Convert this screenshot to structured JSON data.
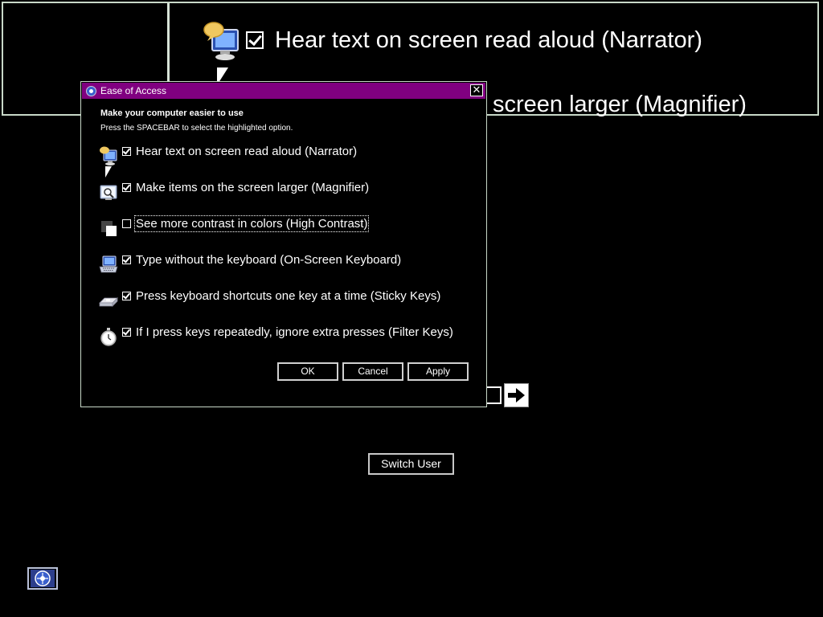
{
  "colors": {
    "title_bar": "#800080",
    "background": "#000000",
    "text": "#ffffff",
    "border": "#c8d8c8"
  },
  "magnifier_view": {
    "row1_text": "Hear text on screen read aloud (Narrator)",
    "row2_text": "screen larger (Magnifier)",
    "row1_checked": true,
    "icon": "narrator-monitor-icon"
  },
  "dialog": {
    "title": "Ease of Access",
    "close_label": "✕",
    "heading": "Make your computer easier to use",
    "instruction": "Press the SPACEBAR to select the highlighted option.",
    "options": [
      {
        "label": "Hear text on screen read aloud (Narrator)",
        "checked": true,
        "icon": "narrator-icon"
      },
      {
        "label": "Make items on the screen larger (Magnifier)",
        "checked": true,
        "icon": "magnifier-icon"
      },
      {
        "label": "See more contrast in colors (High Contrast)",
        "checked": false,
        "icon": "high-contrast-icon",
        "focused": true
      },
      {
        "label": "Type without the keyboard (On-Screen Keyboard)",
        "checked": true,
        "icon": "keyboard-icon"
      },
      {
        "label": "Press keyboard shortcuts one key at a time (Sticky Keys)",
        "checked": true,
        "icon": "sticky-keys-icon"
      },
      {
        "label": "If I press keys repeatedly, ignore extra presses (Filter Keys)",
        "checked": true,
        "icon": "filter-keys-icon"
      }
    ],
    "buttons": {
      "ok": "OK",
      "cancel": "Cancel",
      "apply": "Apply"
    }
  },
  "login": {
    "switch_user_label": "Switch User",
    "go_icon": "arrow-right-icon",
    "ease_of_access_icon": "ease-of-access-icon"
  }
}
